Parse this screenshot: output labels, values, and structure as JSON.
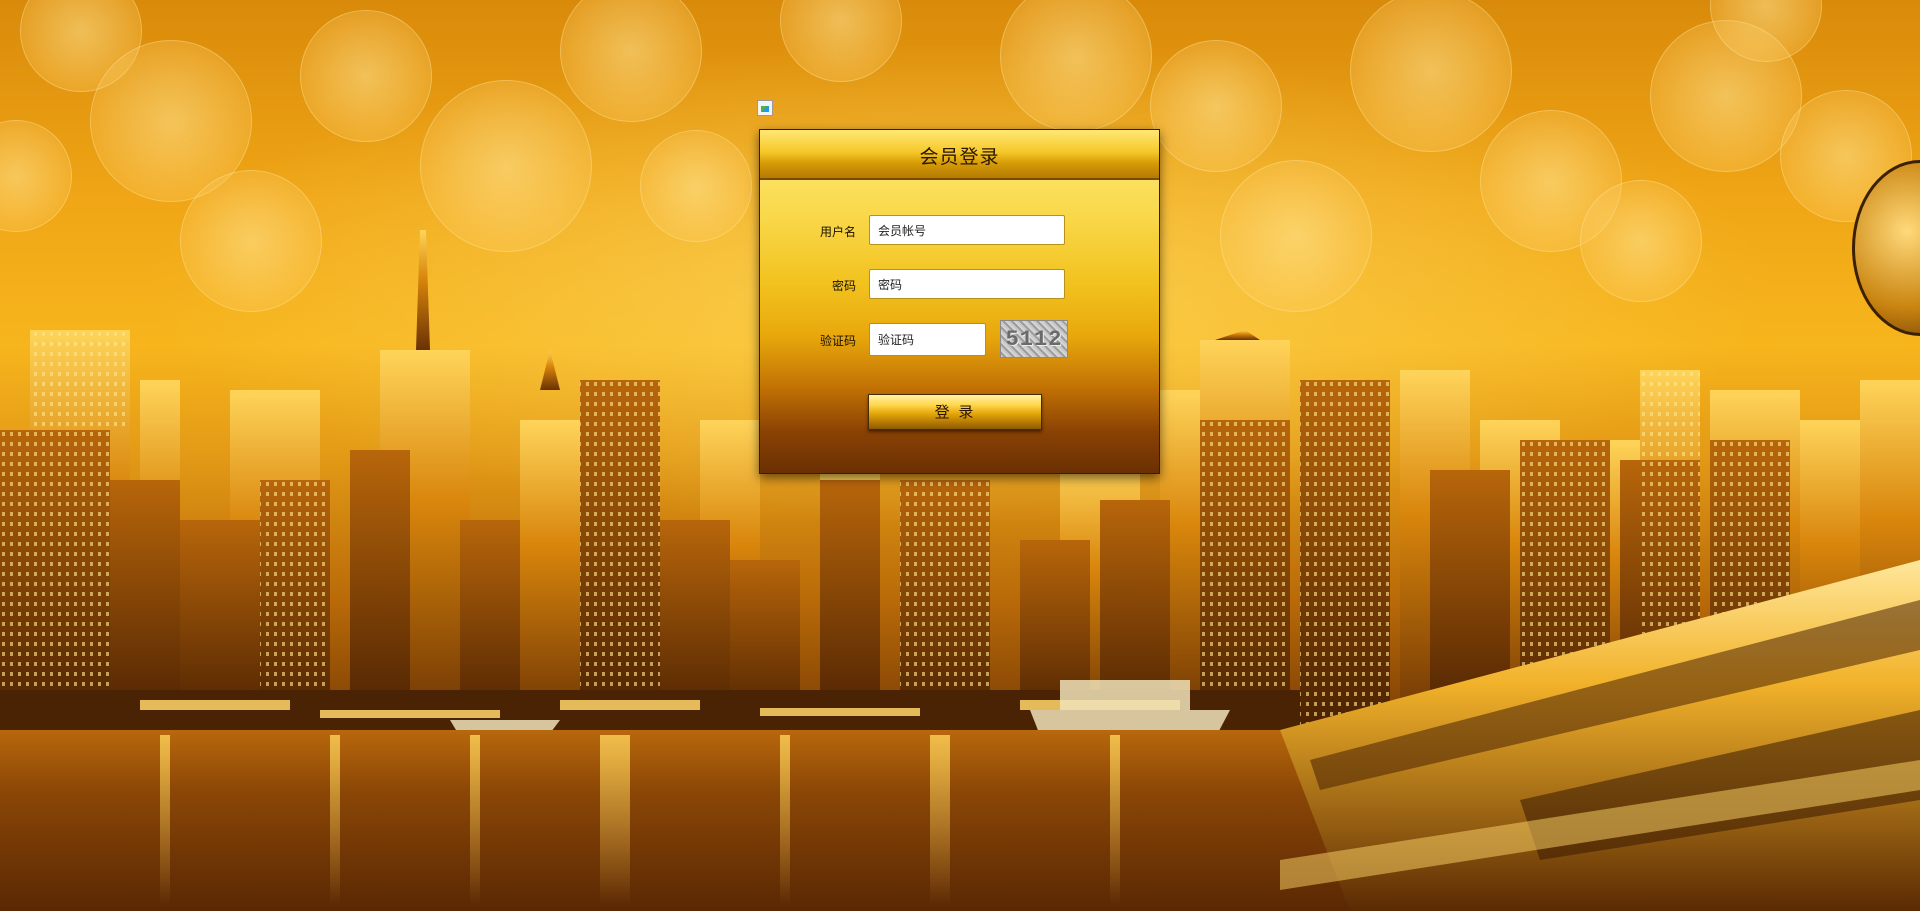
{
  "login": {
    "title": "会员登录",
    "username_label": "用户名",
    "username_value": "会员帐号",
    "password_label": "密码",
    "password_value": "密码",
    "captcha_label": "验证码",
    "captcha_value": "验证码",
    "captcha_code": "5112",
    "submit_label": "登 录"
  },
  "colors": {
    "accent_gold": "#f2c21e",
    "dark_gold": "#8a4204"
  }
}
